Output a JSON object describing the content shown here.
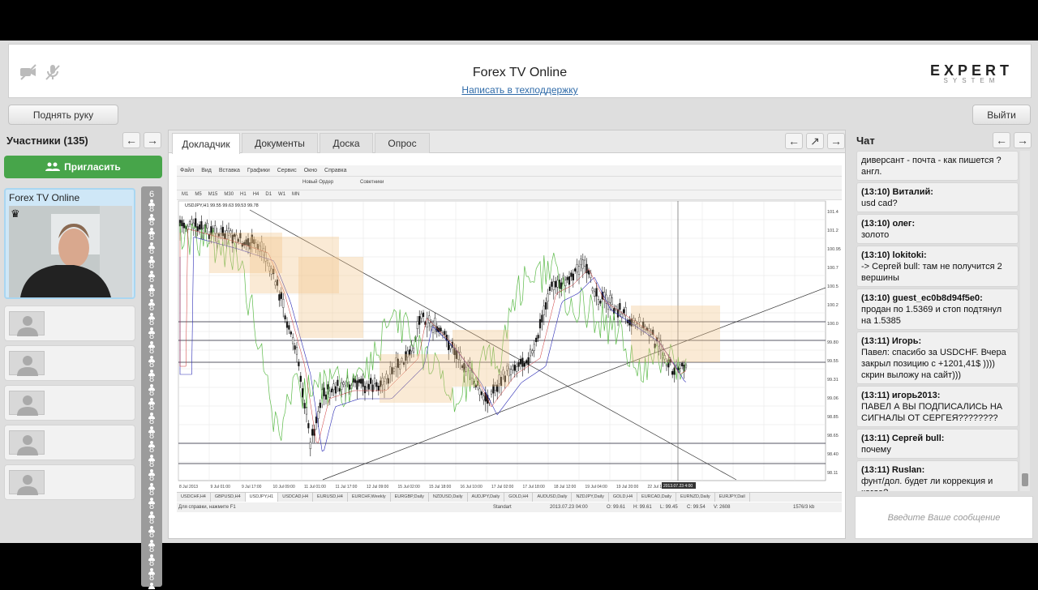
{
  "app": {
    "title": "Forex TV Online",
    "support_link": "Написать в техподдержку",
    "logo_main": "EXPERT",
    "logo_sub": "SYSTEM"
  },
  "toolbar": {
    "raise_hand": "Поднять руку",
    "exit": "Выйти"
  },
  "participants": {
    "title": "Участники (135)",
    "invite": "Пригласить",
    "presenter_name": "Forex TV Online",
    "counts": [
      "6",
      "8",
      "8",
      "8",
      "8",
      "8",
      "8",
      "8",
      "8",
      "8",
      "8",
      "8",
      "8",
      "8",
      "8",
      "8",
      "8",
      "8",
      "8",
      "8",
      "8",
      "8",
      "8",
      "8",
      "8",
      "8",
      "8",
      "8",
      "8",
      "8",
      "8",
      "8",
      "8",
      "8",
      "8",
      "8",
      "8",
      "8",
      "8",
      "8",
      "8"
    ]
  },
  "tabs": [
    "Докладчик",
    "Документы",
    "Доска",
    "Опрос"
  ],
  "chat": {
    "title": "Чат",
    "placeholder": "Введите Ваше сообщение",
    "messages": [
      {
        "head": "",
        "text": "диверсант - почта - как пишется ? англ."
      },
      {
        "head": "(13:10) Виталий:",
        "text": "usd cad?"
      },
      {
        "head": "(13:10) олег:",
        "text": "золото"
      },
      {
        "head": "(13:10) lokitoki:",
        "text": "-> Сергей bull: там не получится 2 вершины"
      },
      {
        "head": "(13:10) guest_ec0b8d94f5e0:",
        "text": "продан по 1.5369 и стоп подтянул на 1.5385"
      },
      {
        "head": "(13:11) Игорь:",
        "text": "Павел: спасибо за USDCHF. Вчера закрыл позицию с +1201,41$ )))) скрин выложу на сайт)))"
      },
      {
        "head": "(13:11) игорь2013:",
        "text": "ПАВЕЛ А ВЫ ПОДПИСАЛИСЬ НА СИГНАЛЫ ОТ СЕРГЕЯ????????"
      },
      {
        "head": "(13:11) Сергей bull:",
        "text": "почему"
      },
      {
        "head": "(13:11) Ruslan:",
        "text": "фунт/дол. будет ли коррекция и когда?"
      }
    ]
  },
  "mt4": {
    "menu": [
      "Файл",
      "Вид",
      "Вставка",
      "Графики",
      "Сервис",
      "Окно",
      "Справка"
    ],
    "btn_order": "Новый Ордер",
    "btn_advisors": "Советники",
    "timeframes": [
      "M1",
      "M5",
      "M15",
      "M30",
      "H1",
      "H4",
      "D1",
      "W1",
      "MN"
    ],
    "symbol_header": "USDJPY,H1  99.55 99.63 99.53 99.78",
    "price_ticks": [
      "101.4",
      "101.2",
      "100.95",
      "100.7",
      "100.5",
      "100.2",
      "100.0",
      "99.80",
      "99.55",
      "99.31",
      "99.06",
      "98.85",
      "98.65",
      "98.40",
      "98.11"
    ],
    "time_ticks": [
      "8 Jul 2013",
      "9 Jul 01:00",
      "9 Jul 17:00",
      "10 Jul 09:00",
      "11 Jul 01:00",
      "11 Jul 17:00",
      "12 Jul 09:00",
      "15 Jul 02:00",
      "15 Jul 18:00",
      "16 Jul 10:00",
      "17 Jul 02:00",
      "17 Jul 18:00",
      "18 Jul 12:00",
      "19 Jul 04:00",
      "19 Jul 20:00",
      "22 Jul 12:00"
    ],
    "cursor_time": "2013.07.23 4:00",
    "symbol_tabs": [
      "USDCHF,H4",
      "GBPUSD,H4",
      "USDJPY,H1",
      "USDCAD,H4",
      "EURUSD,H4",
      "EURCHF,Weekly",
      "EURGBP,Daily",
      "NZDUSD,Daily",
      "AUDJPY,Daily",
      "GOLD,H4",
      "AUDUSD,Daily",
      "NZDJPY,Daily",
      "GOLD,H4",
      "EURCAD,Daily",
      "EURNZD,Daily",
      "EURJPY,Dail"
    ],
    "status": {
      "help": "Для справки, нажмите F1",
      "profile": "Standart",
      "time": "2013.07.23 04:00",
      "open": "O: 99.61",
      "high": "H: 99.61",
      "low": "L: 99.45",
      "close": "C: 99.54",
      "volume": "V: 2608",
      "traffic": "1576/3 kb"
    }
  },
  "colors": {
    "invite": "#47a54a",
    "accent_link": "#2e6aa8"
  }
}
